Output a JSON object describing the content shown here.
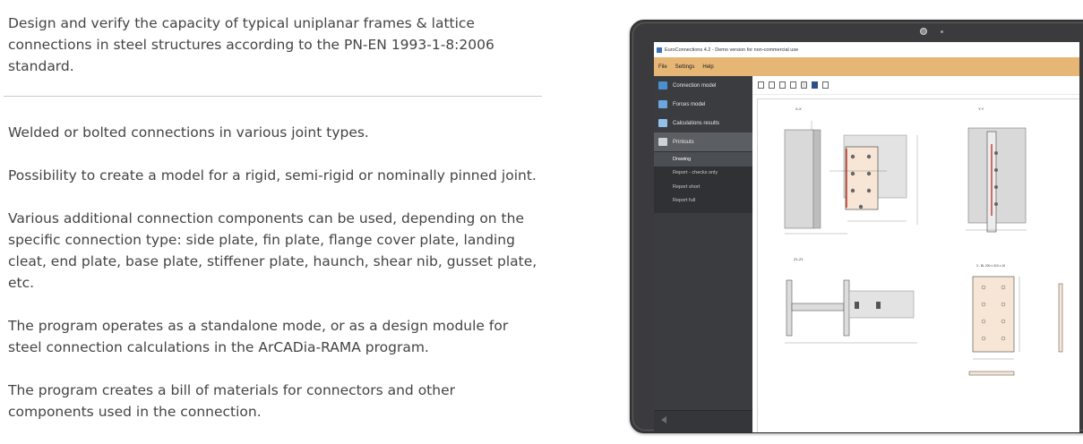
{
  "description": {
    "intro": "Design and verify the capacity of typical uniplanar frames & lattice connections in steel structures according to the PN-EN 1993-1-8:2006 standard.",
    "features": [
      "Welded or bolted connections in various joint types.",
      "Possibility  to create a model for a rigid, semi-rigid or nominally pinned joint.",
      "Various additional connection components can be used, depending on the specific connection type: side plate, fin plate, flange cover plate, landing cleat, end plate, base plate, stiffener plate, haunch, shear nib, gusset plate, etc.",
      "The program operates as a standalone mode, or as a design module for steel connection calculations in the ArCADia-RAMA program.",
      "The program creates a bill of materials for connectors and other components used in the connection."
    ]
  },
  "app": {
    "window_title": "EuroConnections 4.2 - Demo version for non-commercial use",
    "menu": [
      "File",
      "Settings",
      "Help"
    ],
    "sidebar": [
      {
        "label": "Connection model",
        "icon": "connection-model-icon"
      },
      {
        "label": "Forces model",
        "icon": "forces-model-icon"
      },
      {
        "label": "Calculations results",
        "icon": "calculations-icon"
      },
      {
        "label": "Printouts",
        "icon": "printer-icon"
      }
    ],
    "printouts_sub": [
      "Drawing",
      "Report - checks only",
      "Report short",
      "Report full"
    ],
    "toolbar_icons": [
      "new-page-icon",
      "add-page-icon",
      "page-icon",
      "export-page-icon",
      "print-icon",
      "save-icon",
      "report-icon"
    ],
    "drawing_labels": {
      "view_xx": "X-X",
      "view_yy": "Y-Y",
      "view_zz": "Z1-Z1",
      "plate_label": "3 - BL 200 x 310 x 10"
    },
    "colors": {
      "menubar": "#e6b674",
      "sidebar": "#3a3c40",
      "plate_fill": "#f7e6d5",
      "weld": "#c0392b"
    }
  }
}
